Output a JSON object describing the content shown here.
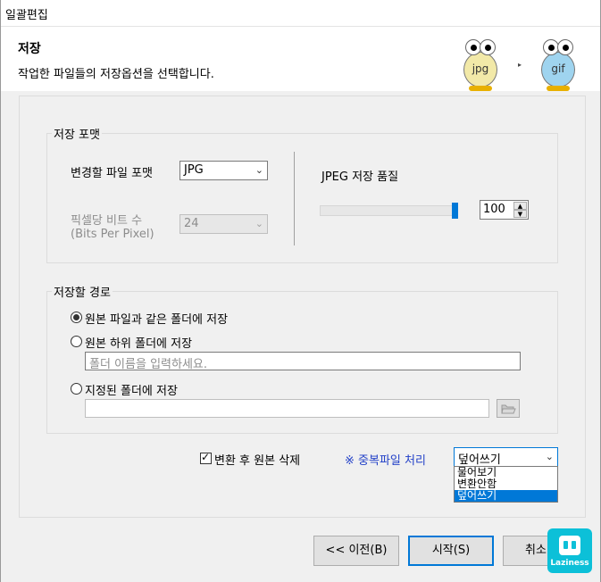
{
  "window": {
    "title": "일괄편집"
  },
  "header": {
    "title": "저장",
    "subtitle": "작업한 파일들의 저장옵션을 선택합니다.",
    "mascot_from": "jpg",
    "mascot_to": "gif",
    "arrow_icon": "▸"
  },
  "save_format": {
    "group_label": "저장 포맷",
    "format_label": "변경할 파일 포맷",
    "format_value": "JPG",
    "bpp_label_line1": "픽셀당 비트 수",
    "bpp_label_line2": "(Bits Per Pixel)",
    "bpp_value": "24",
    "quality_label": "JPEG 저장 품질",
    "quality_value": "100",
    "quality_slider_fraction": 1.0
  },
  "save_path": {
    "group_label": "저장할 경로",
    "options": [
      {
        "label": "원본 파일과 같은 폴더에 저장",
        "checked": true
      },
      {
        "label": "원본 하위 폴더에 저장",
        "checked": false
      },
      {
        "label": "지정된 폴더에 저장",
        "checked": false
      }
    ],
    "subfolder_placeholder": "폴더 이름을 입력하세요.",
    "folder_path_value": ""
  },
  "options": {
    "delete_original_label": "변환 후 원본 삭제",
    "delete_original_checked": true,
    "duplicate_label": "※ 중복파일 처리",
    "duplicate_value": "덮어쓰기",
    "duplicate_options": [
      "물어보기",
      "변환안함",
      "덮어쓰기"
    ],
    "duplicate_selected_index": 2
  },
  "buttons": {
    "back": "<< 이전(B)",
    "start": "시작(S)",
    "cancel": "취소"
  },
  "logo": {
    "text": "Laziness"
  },
  "colors": {
    "accent": "#0078d7",
    "link_blue": "#2341c8",
    "logo_bg": "#0cc0d8",
    "mascot_from": "#f2e9a8",
    "mascot_to": "#9fd4ef"
  },
  "icons": {
    "dropdown": "chevron-down",
    "browse": "folder-open",
    "spin_up": "▲",
    "spin_down": "▼"
  }
}
